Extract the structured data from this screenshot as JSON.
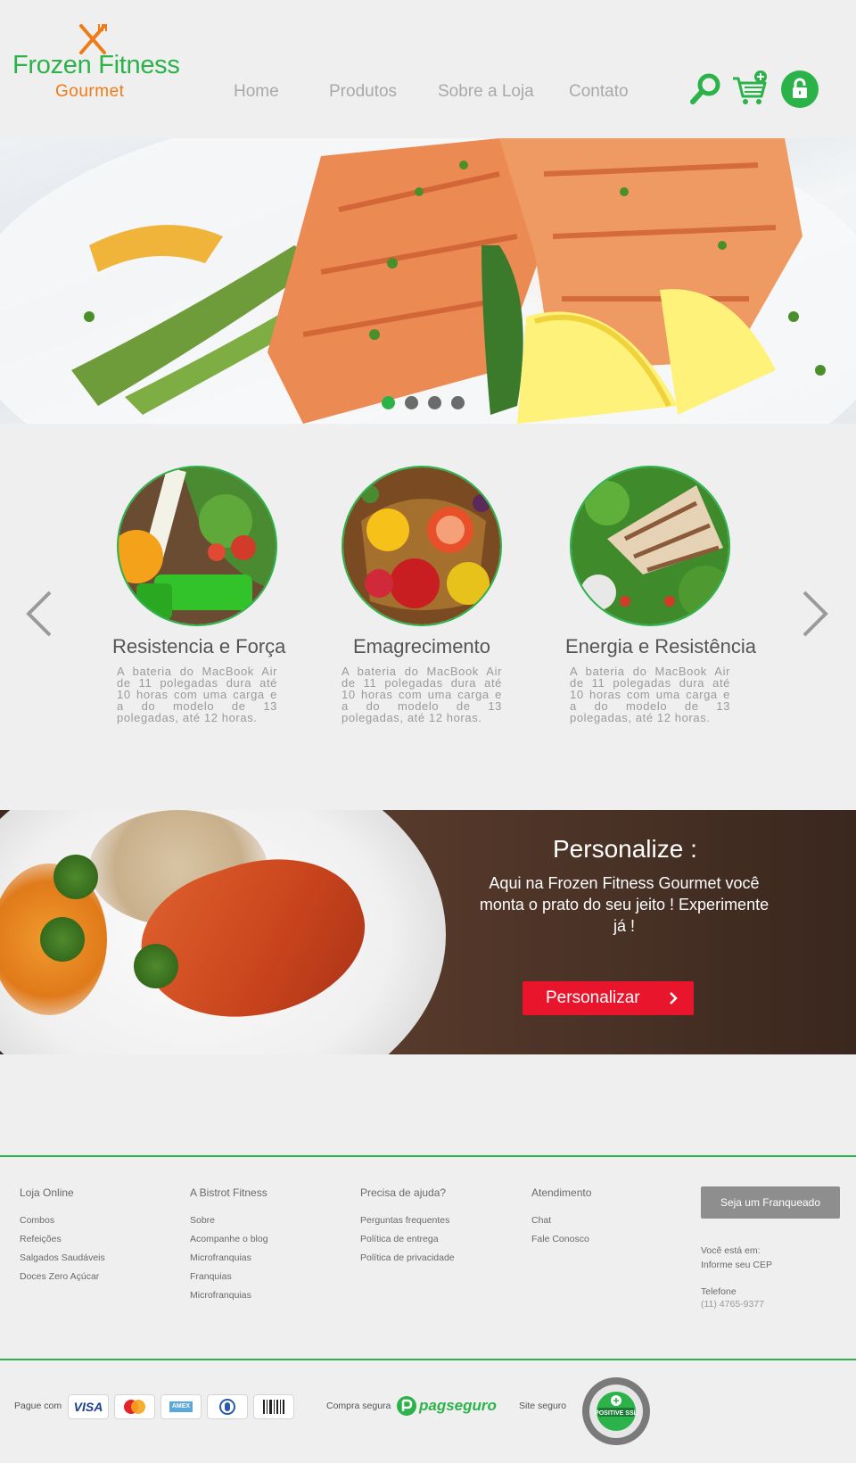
{
  "header": {
    "logo": {
      "title": "Frozen Fitness",
      "subtitle": "Gourmet"
    },
    "nav": [
      {
        "label": "Home"
      },
      {
        "label": "Produtos"
      },
      {
        "label": "Sobre a Loja"
      },
      {
        "label": "Contato"
      }
    ],
    "icons": [
      "search-icon",
      "cart-add-icon",
      "lock-icon"
    ]
  },
  "hero": {
    "slides_total": 4,
    "active_slide": 1
  },
  "features": [
    {
      "title": "Resistencia e Força",
      "description": "A bateria do MacBook Air de 11 polegadas dura até 10 horas com uma carga e a do modelo de 13 polegadas, até 12 horas."
    },
    {
      "title": "Emagrecimento",
      "description": "A bateria do MacBook Air de 11 polegadas dura até 10 horas com uma carga e a do modelo de 13 polegadas, até 12 horas."
    },
    {
      "title": "Energia e Resistência",
      "description": "A bateria do MacBook Air de 11 polegadas dura até 10 horas com uma carga e a do modelo de 13 polegadas, até 12 horas."
    }
  ],
  "banner": {
    "title": "Personalize :",
    "text": "Aqui na Frozen Fitness Gourmet você monta o prato do seu jeito ! Experimente já !",
    "button": "Personalizar"
  },
  "footer": {
    "columns": [
      {
        "title": "Loja Online",
        "links": [
          "Combos",
          "Refeições",
          "Salgados Saudáveis",
          "Doces Zero Açúcar"
        ]
      },
      {
        "title": "A Bistrot Fitness",
        "links": [
          "Sobre",
          "Acompanhe o blog",
          "Microfranquias",
          "Franquias",
          "Microfranquias"
        ]
      },
      {
        "title": "Precisa de ajuda?",
        "links": [
          "Perguntas frequentes",
          "Política de entrega",
          "Política de privacidade"
        ]
      },
      {
        "title": "Atendimento",
        "links": [
          "Chat",
          "Fale Conosco"
        ]
      }
    ],
    "franchise_button": "Seja um Franqueado",
    "location_label": "Você está em:",
    "location_value": "Informe seu CEP",
    "phone_label": "Telefone",
    "phone_value": "(11) 4765-9377"
  },
  "bottom_bar": {
    "pay_label": "Pague com",
    "cards": [
      {
        "name": "visa",
        "label": "VISA"
      },
      {
        "name": "mastercard",
        "label": "MasterCard"
      },
      {
        "name": "amex",
        "label": "AMEX"
      },
      {
        "name": "diners",
        "label": ""
      },
      {
        "name": "boleto",
        "label": ""
      }
    ],
    "secure_purchase_label": "Compra segura",
    "pagseguro_label": "pagseguro",
    "secure_site_label": "Site seguro",
    "ssl_label": "POSITIVE SSL"
  },
  "colors": {
    "brand_green": "#2bb34a",
    "brand_orange": "#f07b14",
    "cta_red": "#e8152c",
    "nav_gray": "#a9a9a9"
  }
}
